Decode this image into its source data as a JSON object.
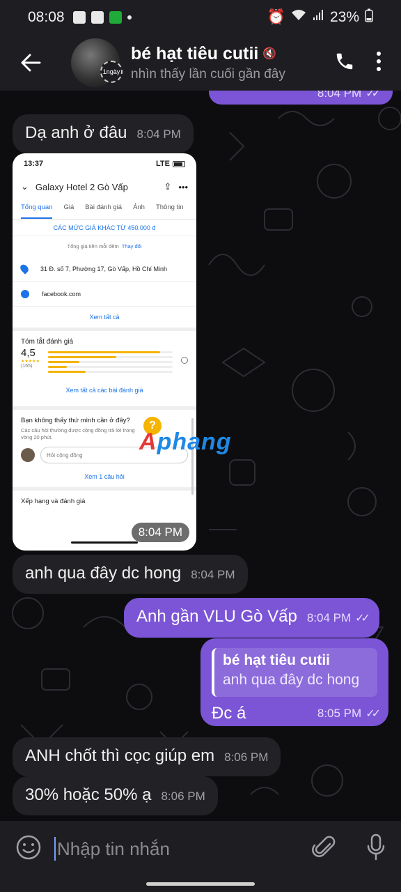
{
  "status_bar": {
    "time": "08:08",
    "battery": "23%"
  },
  "header": {
    "contact_name": "bé hạt tiêu cutii",
    "last_seen": "nhìn thấy lần cuối gần đây",
    "story_badge": "1ngày"
  },
  "messages": [
    {
      "dir": "out",
      "text": "",
      "time": "8:04 PM"
    },
    {
      "dir": "in",
      "text": "Dạ anh ở đâu",
      "time": "8:04 PM"
    },
    {
      "dir": "in",
      "type": "photo",
      "time": "8:04 PM"
    },
    {
      "dir": "in",
      "text": "anh qua đây dc hong",
      "time": "8:04 PM"
    },
    {
      "dir": "out",
      "text": "Anh gần VLU Gò Vấp",
      "time": "8:04 PM"
    },
    {
      "dir": "out",
      "text": "Đc á",
      "time": "8:05 PM",
      "reply_to_name": "bé hạt tiêu cutii",
      "reply_to_text": "anh qua đây dc hong"
    },
    {
      "dir": "in",
      "text": "ANH chốt thì cọc giúp em",
      "time": "8:06 PM"
    },
    {
      "dir": "in",
      "text": "30% hoặc 50% ạ",
      "time": "8:06 PM"
    }
  ],
  "photo": {
    "status_time": "13:37",
    "network": "LTE",
    "place_name": "Galaxy Hotel 2 Gò Vấp",
    "tabs": [
      "Tổng quan",
      "Giá",
      "Bài đánh giá",
      "Ảnh",
      "Thông tin"
    ],
    "price_link": "CÁC MỨC GIÁ KHÁC TỪ 450.000 đ",
    "total_text": "Tổng giá tiền mỗi đêm",
    "change_link": "Thay đổi",
    "address": "31 Đ. số 7, Phường 17, Gò Vấp, Hồ Chí Minh",
    "website": "facebook.com",
    "see_all": "Xem tất cả",
    "summary_title": "Tóm tắt đánh giá",
    "rating": "4,5",
    "stars": "★★★★★",
    "review_count": "(165)",
    "rating_bars": [
      0.9,
      0.55,
      0.25,
      0.15,
      0.3
    ],
    "see_all_reviews": "Xem tất cả các bài đánh giá",
    "question_title": "Bạn không thấy thứ mình cần ở đây?",
    "question_sub": "Các câu hỏi thường được cộng đồng trả lời trong vòng 20 phút.",
    "ask_placeholder": "Hỏi cộng đồng",
    "see_question": "Xem 1 câu hỏi",
    "rank_title": "Xếp hạng và đánh giá"
  },
  "watermark": {
    "part_a": "A",
    "part_b": "phang"
  },
  "input": {
    "placeholder": "Nhập tin nhắn"
  },
  "colors": {
    "accent": "#7b55d6",
    "incoming_bubble": "#222226",
    "header": "#1e1e22"
  }
}
